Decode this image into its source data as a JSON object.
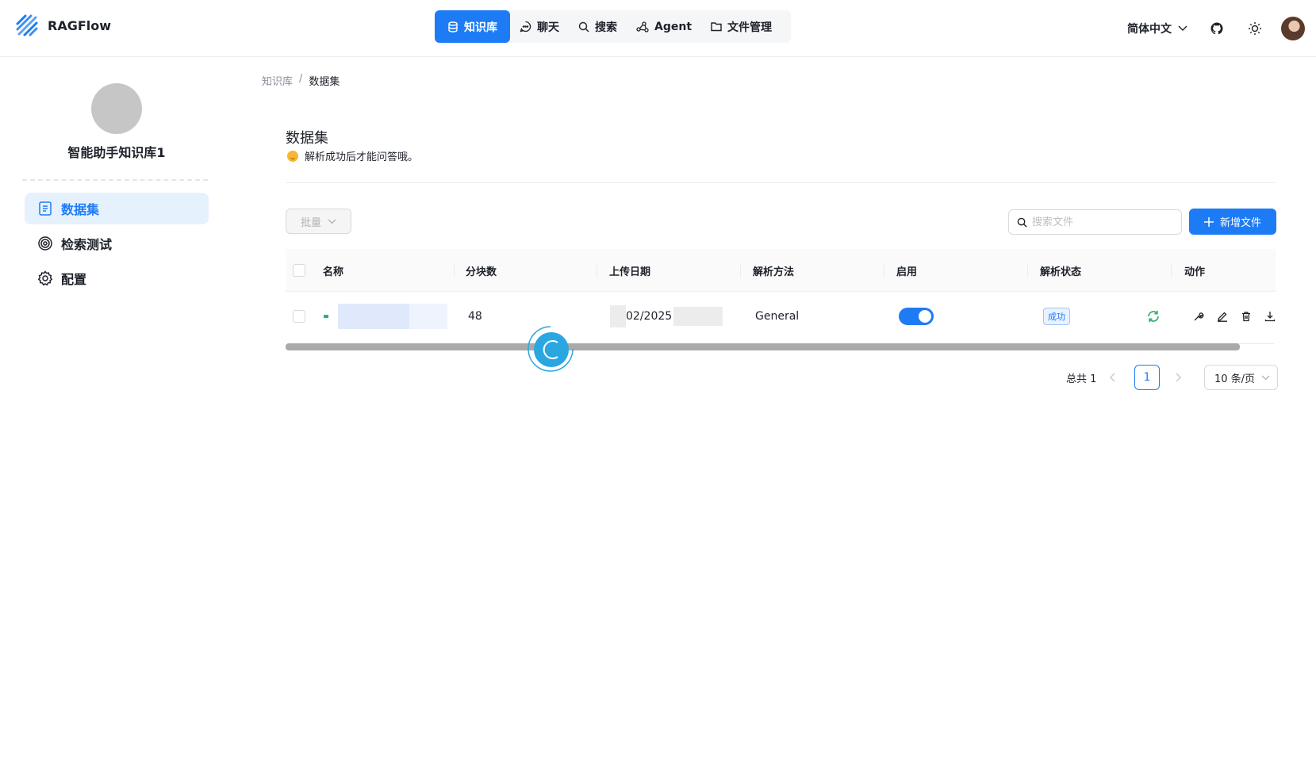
{
  "header": {
    "brand": "RAGFlow",
    "nav": [
      {
        "label": "知识库",
        "icon": "database-icon",
        "active": true
      },
      {
        "label": "聊天",
        "icon": "chat-icon",
        "active": false
      },
      {
        "label": "搜索",
        "icon": "search-icon",
        "active": false
      },
      {
        "label": "Agent",
        "icon": "agent-graph-icon",
        "active": false
      },
      {
        "label": "文件管理",
        "icon": "folder-icon",
        "active": false
      }
    ],
    "language": "简体中文",
    "icons": [
      "github-icon",
      "sun-icon",
      "user-avatar"
    ]
  },
  "sidebar": {
    "kb_name": "智能助手知识库1",
    "items": [
      {
        "label": "数据集",
        "icon": "document-icon",
        "active": true
      },
      {
        "label": "检索测试",
        "icon": "target-icon",
        "active": false
      },
      {
        "label": "配置",
        "icon": "gear-icon",
        "active": false
      }
    ]
  },
  "breadcrumb": {
    "root": "知识库",
    "separator": "/",
    "current": "数据集"
  },
  "page": {
    "title": "数据集",
    "subtitle": "解析成功后才能问答哦。"
  },
  "toolbar": {
    "bulk_label": "批量",
    "search_placeholder": "搜索文件",
    "add_label": "新增文件"
  },
  "table": {
    "columns": [
      "名称",
      "分块数",
      "上传日期",
      "解析方法",
      "启用",
      "解析状态",
      "动作"
    ],
    "rows": [
      {
        "name": "",
        "chunks": "48",
        "upload_date": "02/2025",
        "method": "General",
        "enabled": true,
        "status": "成功"
      }
    ]
  },
  "pagination": {
    "total": "总共 1",
    "current_page": "1",
    "page_size": "10 条/页"
  },
  "colors": {
    "accent": "#1d7cf5",
    "success": "#2fb36f"
  }
}
